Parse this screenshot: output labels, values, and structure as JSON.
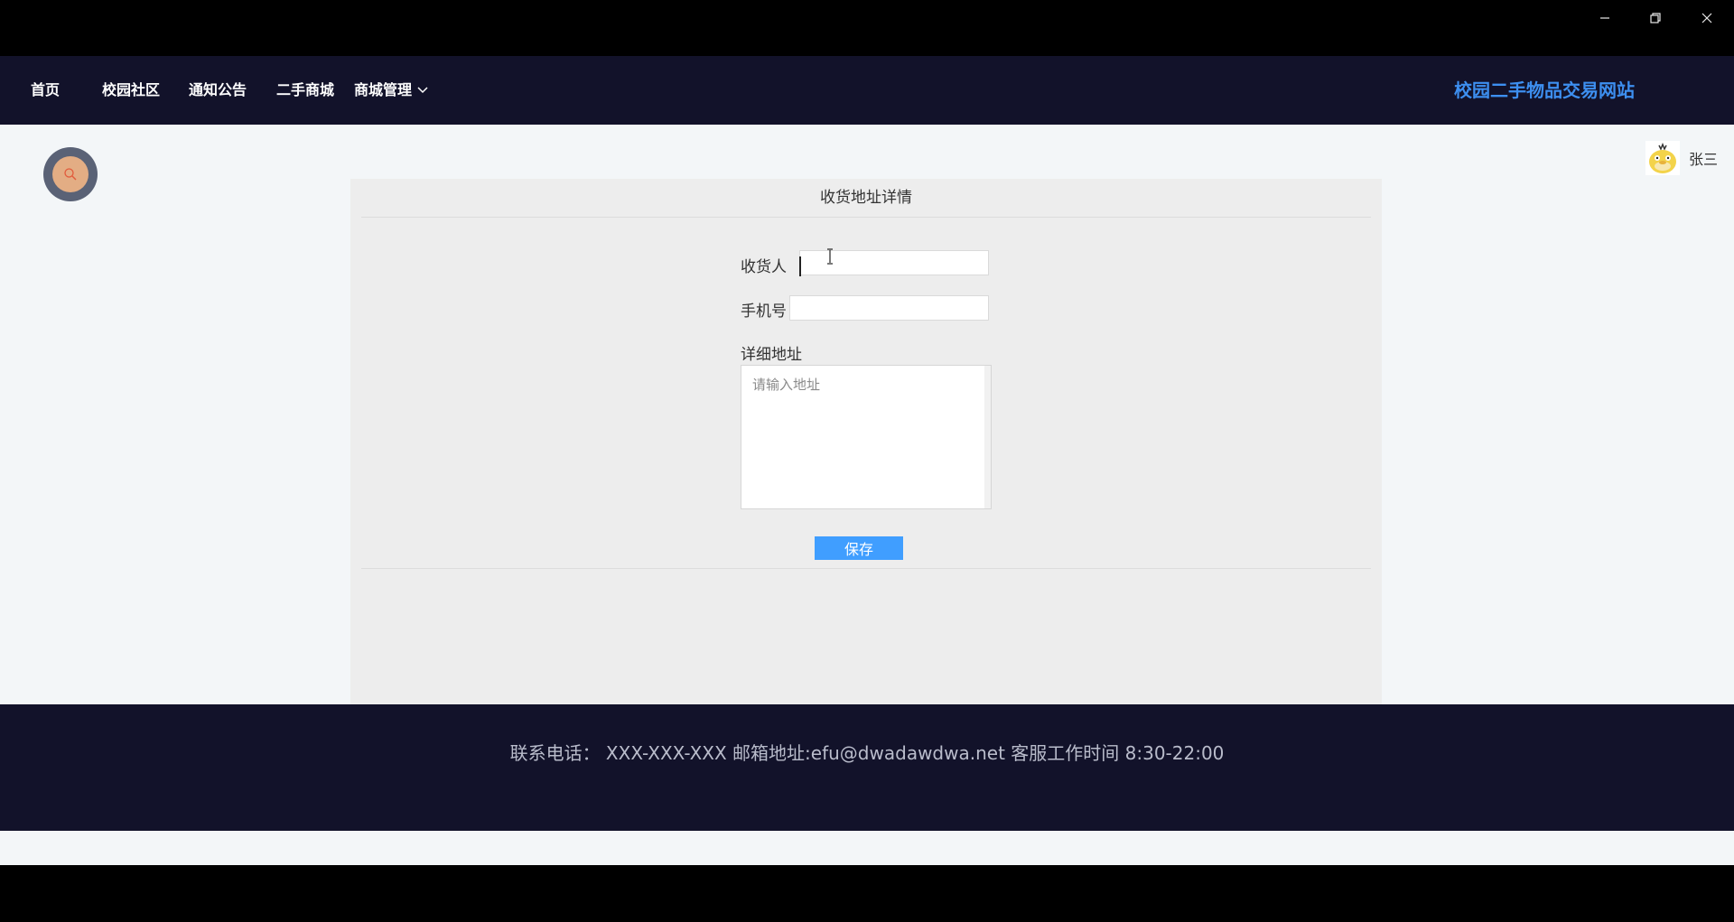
{
  "window": {
    "minimize_icon": "minimize-icon",
    "maximize_icon": "restore-icon",
    "close_icon": "close-icon"
  },
  "nav": {
    "items": [
      {
        "label": "首页"
      },
      {
        "label": "校园社区"
      },
      {
        "label": "通知公告"
      },
      {
        "label": "二手商城"
      },
      {
        "label": "商城管理"
      }
    ],
    "site_title": "校园二手物品交易网站"
  },
  "user": {
    "name": "张三"
  },
  "panel": {
    "title": "收货地址详情",
    "form": {
      "recipient_label": "收货人",
      "recipient_value": "",
      "phone_label": "手机号",
      "phone_value": "",
      "address_label": "详细地址",
      "address_placeholder": "请输入地址",
      "save_label": "保存"
    }
  },
  "footer": {
    "text": "联系电话： XXX-XXX-XXX 邮箱地址:efu@dwadawdwa.net 客服工作时间 8:30-22:00"
  },
  "colors": {
    "nav_bg": "#12122a",
    "site_title": "#3d8ff0",
    "primary_button": "#409eff",
    "page_bg": "#f3f6f8",
    "panel_bg": "#ededed"
  }
}
